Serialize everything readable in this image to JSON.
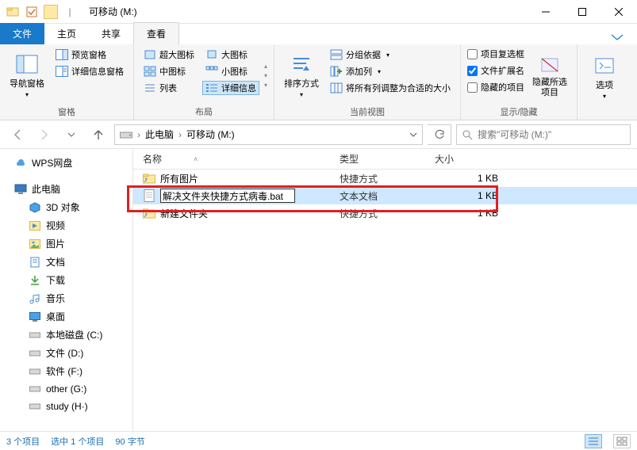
{
  "title": "可移动 (M:)",
  "tabs": {
    "file": "文件",
    "home": "主页",
    "share": "共享",
    "view": "查看"
  },
  "ribbon": {
    "panes": {
      "nav_pane": "导航窗格",
      "preview_pane": "预览窗格",
      "details_pane": "详细信息窗格",
      "label": "窗格"
    },
    "layout": {
      "extra_large": "超大图标",
      "large": "大图标",
      "medium": "中图标",
      "small": "小图标",
      "list": "列表",
      "details": "详细信息",
      "label": "布局"
    },
    "current": {
      "sort": "排序方式",
      "group": "分组依据",
      "add_col": "添加列",
      "fit_cols": "将所有列调整为合适的大小",
      "label": "当前视图"
    },
    "showhide": {
      "item_checkboxes": "项目复选框",
      "file_ext": "文件扩展名",
      "hidden_items": "隐藏的项目",
      "hide_selected": "隐藏所选项目",
      "label": "显示/隐藏"
    },
    "options": "选项"
  },
  "breadcrumb": {
    "this_pc": "此电脑",
    "drive": "可移动 (M:)"
  },
  "search_placeholder": "搜索\"可移动 (M:)\"",
  "sidebar": {
    "wps": "WPS网盘",
    "this_pc": "此电脑",
    "objects3d": "3D 对象",
    "videos": "视频",
    "pictures": "图片",
    "documents": "文档",
    "downloads": "下载",
    "music": "音乐",
    "desktop": "桌面",
    "disk_c": "本地磁盘 (C:)",
    "disk_d": "文件 (D:)",
    "disk_f": "软件 (F:)",
    "disk_g": "other (G:)",
    "disk_h": "study (H·)"
  },
  "columns": {
    "name": "名称",
    "type": "类型",
    "size": "大小"
  },
  "files": [
    {
      "name": "所有图片",
      "type": "快捷方式",
      "size": "1 KB",
      "icon": "folder"
    },
    {
      "name": "解决文件夹快捷方式病毒.bat",
      "type": "文本文档",
      "size": "1 KB",
      "icon": "text",
      "selected": true,
      "editing": true
    },
    {
      "name": "新建文件夹",
      "type": "快捷方式",
      "size": "1 KB",
      "icon": "folder"
    }
  ],
  "status": {
    "count": "3 个项目",
    "selected": "选中 1 个项目",
    "bytes": "90 字节"
  }
}
